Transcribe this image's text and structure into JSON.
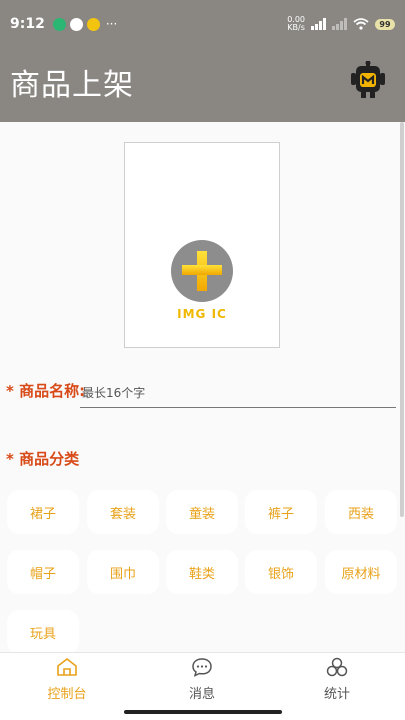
{
  "status_bar": {
    "time": "9:12",
    "more": "···",
    "net_speed": "0.00",
    "net_unit": "KB/s",
    "battery": "99"
  },
  "header": {
    "title": "商品上架",
    "avatar_icon": "robot-m-icon"
  },
  "upload": {
    "caption": "IMG IC",
    "icon": "plus-icon",
    "accent": "#f0b800"
  },
  "form": {
    "required_mark": "*",
    "name_label": "商品名称:",
    "name_placeholder": "最长16个字",
    "category_label": "商品分类"
  },
  "categories": [
    "裙子",
    "套装",
    "童装",
    "裤子",
    "西装",
    "帽子",
    "围巾",
    "鞋类",
    "银饰",
    "原材料",
    "玩具"
  ],
  "tabs": [
    {
      "label": "控制台",
      "icon": "home-icon",
      "active": true
    },
    {
      "label": "消息",
      "icon": "chat-icon",
      "active": false
    },
    {
      "label": "统计",
      "icon": "stats-icon",
      "active": false
    }
  ],
  "colors": {
    "header_bg": "#8a8783",
    "accent_orange": "#e8a21a",
    "required_red": "#d84a18"
  }
}
